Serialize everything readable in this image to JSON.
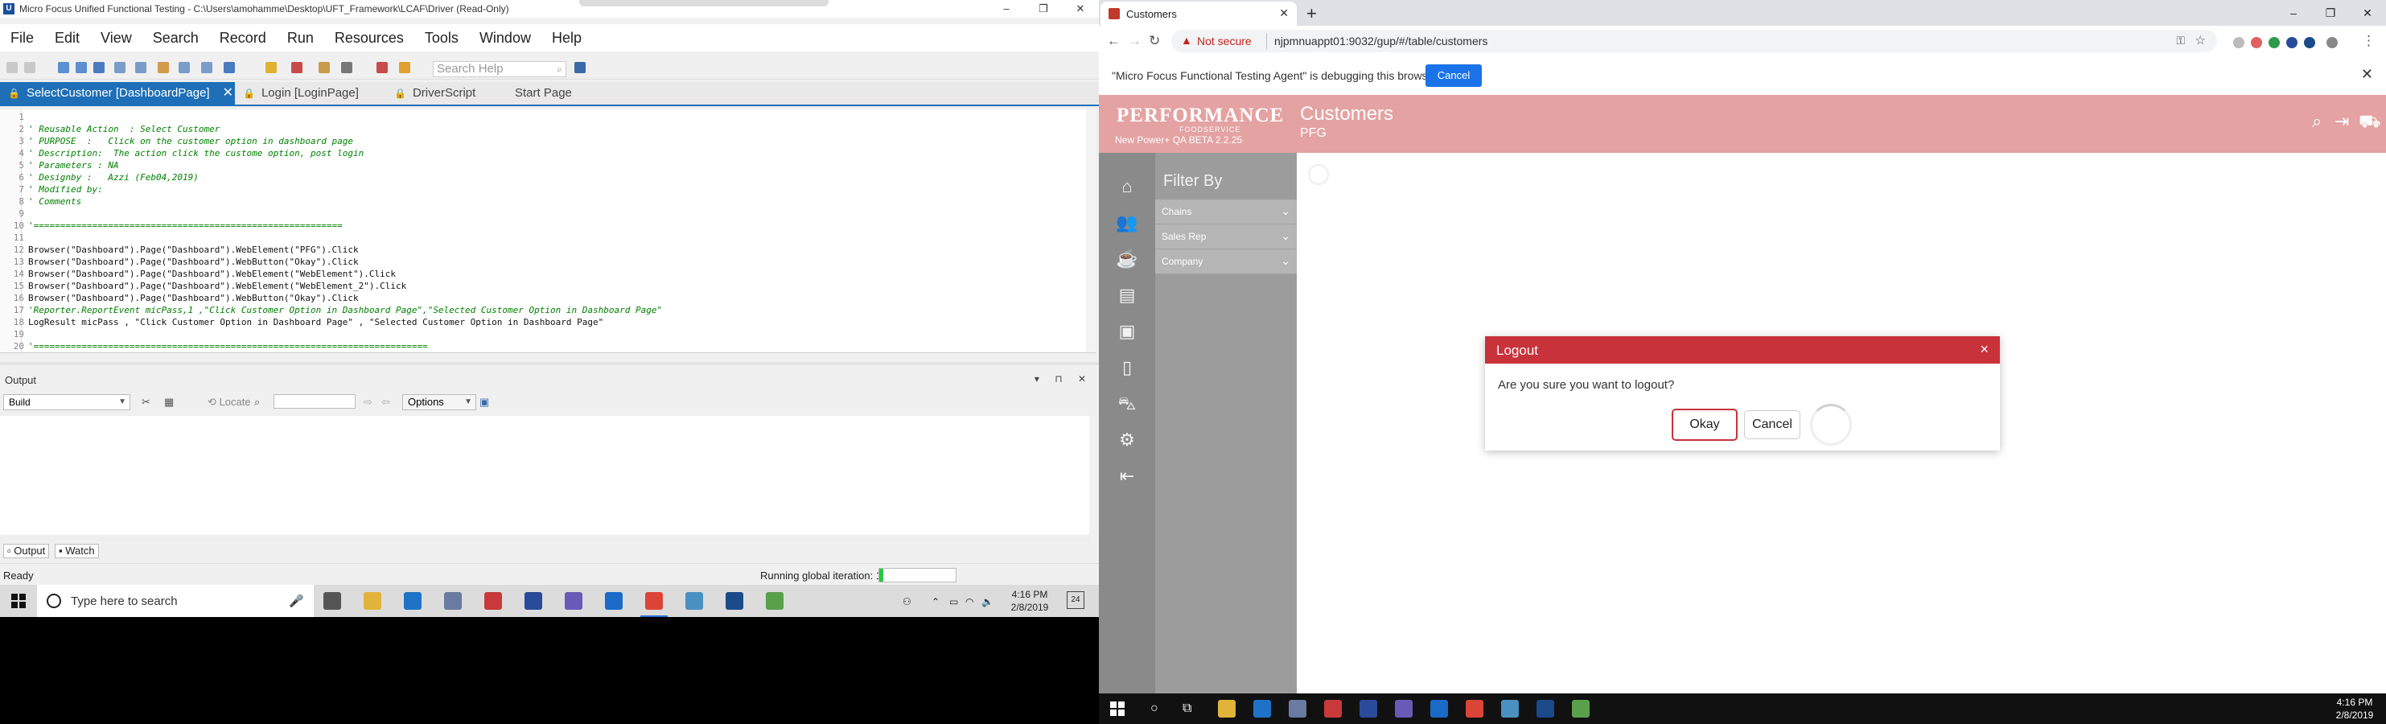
{
  "uft": {
    "window_title": "Micro Focus Unified Functional Testing - C:\\Users\\amohamme\\Desktop\\UFT_Framework\\LCAF\\Driver (Read-Only)",
    "window_controls": [
      "–",
      "❐",
      "✕"
    ],
    "menu": [
      "File",
      "Edit",
      "View",
      "Search",
      "Record",
      "Run",
      "Resources",
      "Tools",
      "Window",
      "Help"
    ],
    "search_help_placeholder": "Search Help",
    "tabs": [
      {
        "label": "SelectCustomer [DashboardPage]",
        "active": true
      },
      {
        "label": "Login [LoginPage]",
        "active": false
      },
      {
        "label": "DriverScript",
        "active": false
      },
      {
        "label": "Start Page",
        "active": false
      }
    ],
    "code_lines": [
      {
        "n": "1",
        "text": "",
        "kind": "code"
      },
      {
        "n": "2",
        "text": "' Reusable Action  : Select Customer",
        "kind": "comment"
      },
      {
        "n": "3",
        "text": "' PURPOSE  :   Click on the customer option in dashboard page",
        "kind": "comment"
      },
      {
        "n": "4",
        "text": "' Description:  The action click the custome option, post login",
        "kind": "comment"
      },
      {
        "n": "5",
        "text": "' Parameters : NA",
        "kind": "comment"
      },
      {
        "n": "6",
        "text": "' Designby :   Azzi (Feb04,2019)",
        "kind": "comment"
      },
      {
        "n": "7",
        "text": "' Modified by:",
        "kind": "comment"
      },
      {
        "n": "8",
        "text": "' Comments",
        "kind": "comment"
      },
      {
        "n": "9",
        "text": "",
        "kind": "code"
      },
      {
        "n": "10",
        "text": "'==========================================================",
        "kind": "comment"
      },
      {
        "n": "11",
        "text": "",
        "kind": "code"
      },
      {
        "n": "12",
        "text": "Browser(\"Dashboard\").Page(\"Dashboard\").WebElement(\"PFG\").Click",
        "kind": "code"
      },
      {
        "n": "13",
        "text": "Browser(\"Dashboard\").Page(\"Dashboard\").WebButton(\"Okay\").Click",
        "kind": "code"
      },
      {
        "n": "14",
        "text": "Browser(\"Dashboard\").Page(\"Dashboard\").WebElement(\"WebElement\").Click",
        "kind": "code"
      },
      {
        "n": "15",
        "text": "Browser(\"Dashboard\").Page(\"Dashboard\").WebElement(\"WebElement_2\").Click",
        "kind": "code"
      },
      {
        "n": "16",
        "text": "Browser(\"Dashboard\").Page(\"Dashboard\").WebButton(\"Okay\").Click",
        "kind": "code"
      },
      {
        "n": "17",
        "text": "'Reporter.ReportEvent micPass,1 ,\"Click Customer Option in Dashboard Page\",\"Selected Customer Option in Dashboard Page\"",
        "kind": "comment"
      },
      {
        "n": "18",
        "text": "LogResult micPass , \"Click Customer Option in Dashboard Page\" , \"Selected Customer Option in Dashboard Page\"",
        "kind": "code"
      },
      {
        "n": "19",
        "text": "",
        "kind": "code"
      },
      {
        "n": "20",
        "text": "'==========================================================================",
        "kind": "comment"
      }
    ],
    "output": {
      "title": "Output",
      "pane_controls": "▾ ⊓ ✕",
      "build_select": "Build",
      "locate_label": "Locate",
      "options_label": "Options",
      "bottom_tabs": [
        "Output",
        "Watch"
      ]
    },
    "status": {
      "ready": "Ready",
      "iteration_text": "Running global iteration: 1",
      "iteration_progress": 0.05
    }
  },
  "taskbar_left": {
    "search_placeholder": "Type here to search",
    "time": "4:16 PM",
    "date": "2/8/2019",
    "notifications": "24"
  },
  "chrome": {
    "tab_title": "Customers",
    "new_tab": "+",
    "not_secure": "Not secure",
    "url": "njpmnuappt01:9032/gup/#/table/customers",
    "infobar_message": "\"Micro Focus Functional Testing Agent\" is debugging this browser",
    "infobar_cancel": "Cancel"
  },
  "app": {
    "brand": "PERFORMANCE",
    "brand_sub": "FOODSERVICE",
    "version": "New Power+ QA BETA 2.2.25",
    "page_title": "Customers",
    "page_subtitle": "PFG",
    "filter_title": "Filter By",
    "filters": [
      "Chains",
      "Sales Rep",
      "Company"
    ]
  },
  "modal": {
    "title": "Logout",
    "close": "×",
    "message": "Are you sure you want to logout?",
    "okay": "Okay",
    "cancel": "Cancel"
  },
  "taskbar_right": {
    "time": "4:16 PM",
    "date": "2/8/2019"
  },
  "colors": {
    "uft_tab_active": "#1e6fb8",
    "comment": "#008000",
    "app_header": "#e4a2a2",
    "modal_header": "#c8323a",
    "chrome_button": "#1a73e8"
  }
}
